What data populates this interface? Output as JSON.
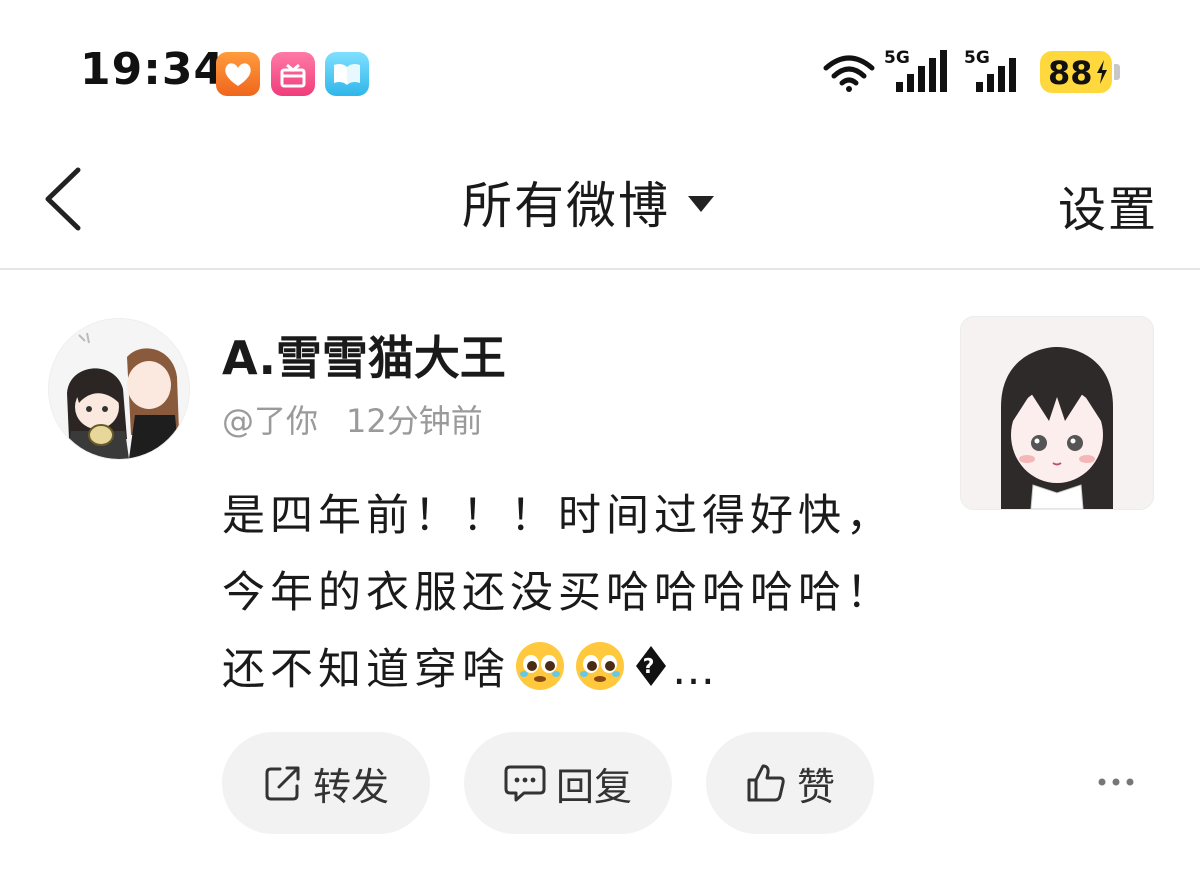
{
  "status_bar": {
    "time": "19:34",
    "app_icons": [
      "health-heart-icon",
      "gift-icon",
      "book-icon"
    ],
    "network_1": "5G",
    "network_2": "5G",
    "battery": "88"
  },
  "nav": {
    "title": "所有微博",
    "settings_label": "设置"
  },
  "post": {
    "username": "A.雪雪猫大王",
    "mention": "@了你",
    "time": "12分钟前",
    "text_parts": [
      "是四年前！！！时间过得好快，今年的衣服还没买哈哈哈哈哈！还不知道穿啥",
      "…"
    ],
    "actions": {
      "repost": "转发",
      "comment": "回复",
      "like": "赞"
    }
  },
  "colors": {
    "battery": "#ffd83d",
    "text_primary": "#1a1a1a",
    "text_secondary": "#9a9a9a",
    "button_bg": "#f2f2f2"
  }
}
